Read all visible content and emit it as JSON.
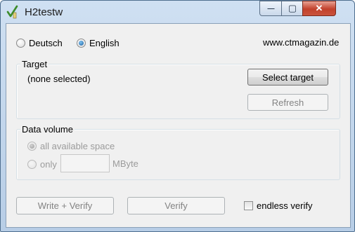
{
  "window": {
    "title": "H2testw",
    "minimize_glyph": "—",
    "maximize_glyph": "▢",
    "close_glyph": "✕"
  },
  "language": {
    "options": [
      {
        "label": "Deutsch",
        "checked": false
      },
      {
        "label": "English",
        "checked": true
      }
    ],
    "website": "www.ctmagazin.de"
  },
  "target": {
    "legend": "Target",
    "selection": "(none selected)",
    "select_button": "Select target",
    "refresh_button": "Refresh"
  },
  "data_volume": {
    "legend": "Data volume",
    "all_space_label": "all available space",
    "only_label": "only",
    "size_value": "",
    "unit": "MByte"
  },
  "actions": {
    "write_verify": "Write + Verify",
    "verify": "Verify",
    "endless_verify": "endless verify",
    "endless_checked": false
  },
  "colors": {
    "accent": "#1c5e9e",
    "disabled_text": "#9b9b9b",
    "close_button": "#c2412c"
  },
  "icons": {
    "app": "check-pencil-icon",
    "minimize": "minimize-icon",
    "maximize": "maximize-icon",
    "close": "close-icon"
  }
}
